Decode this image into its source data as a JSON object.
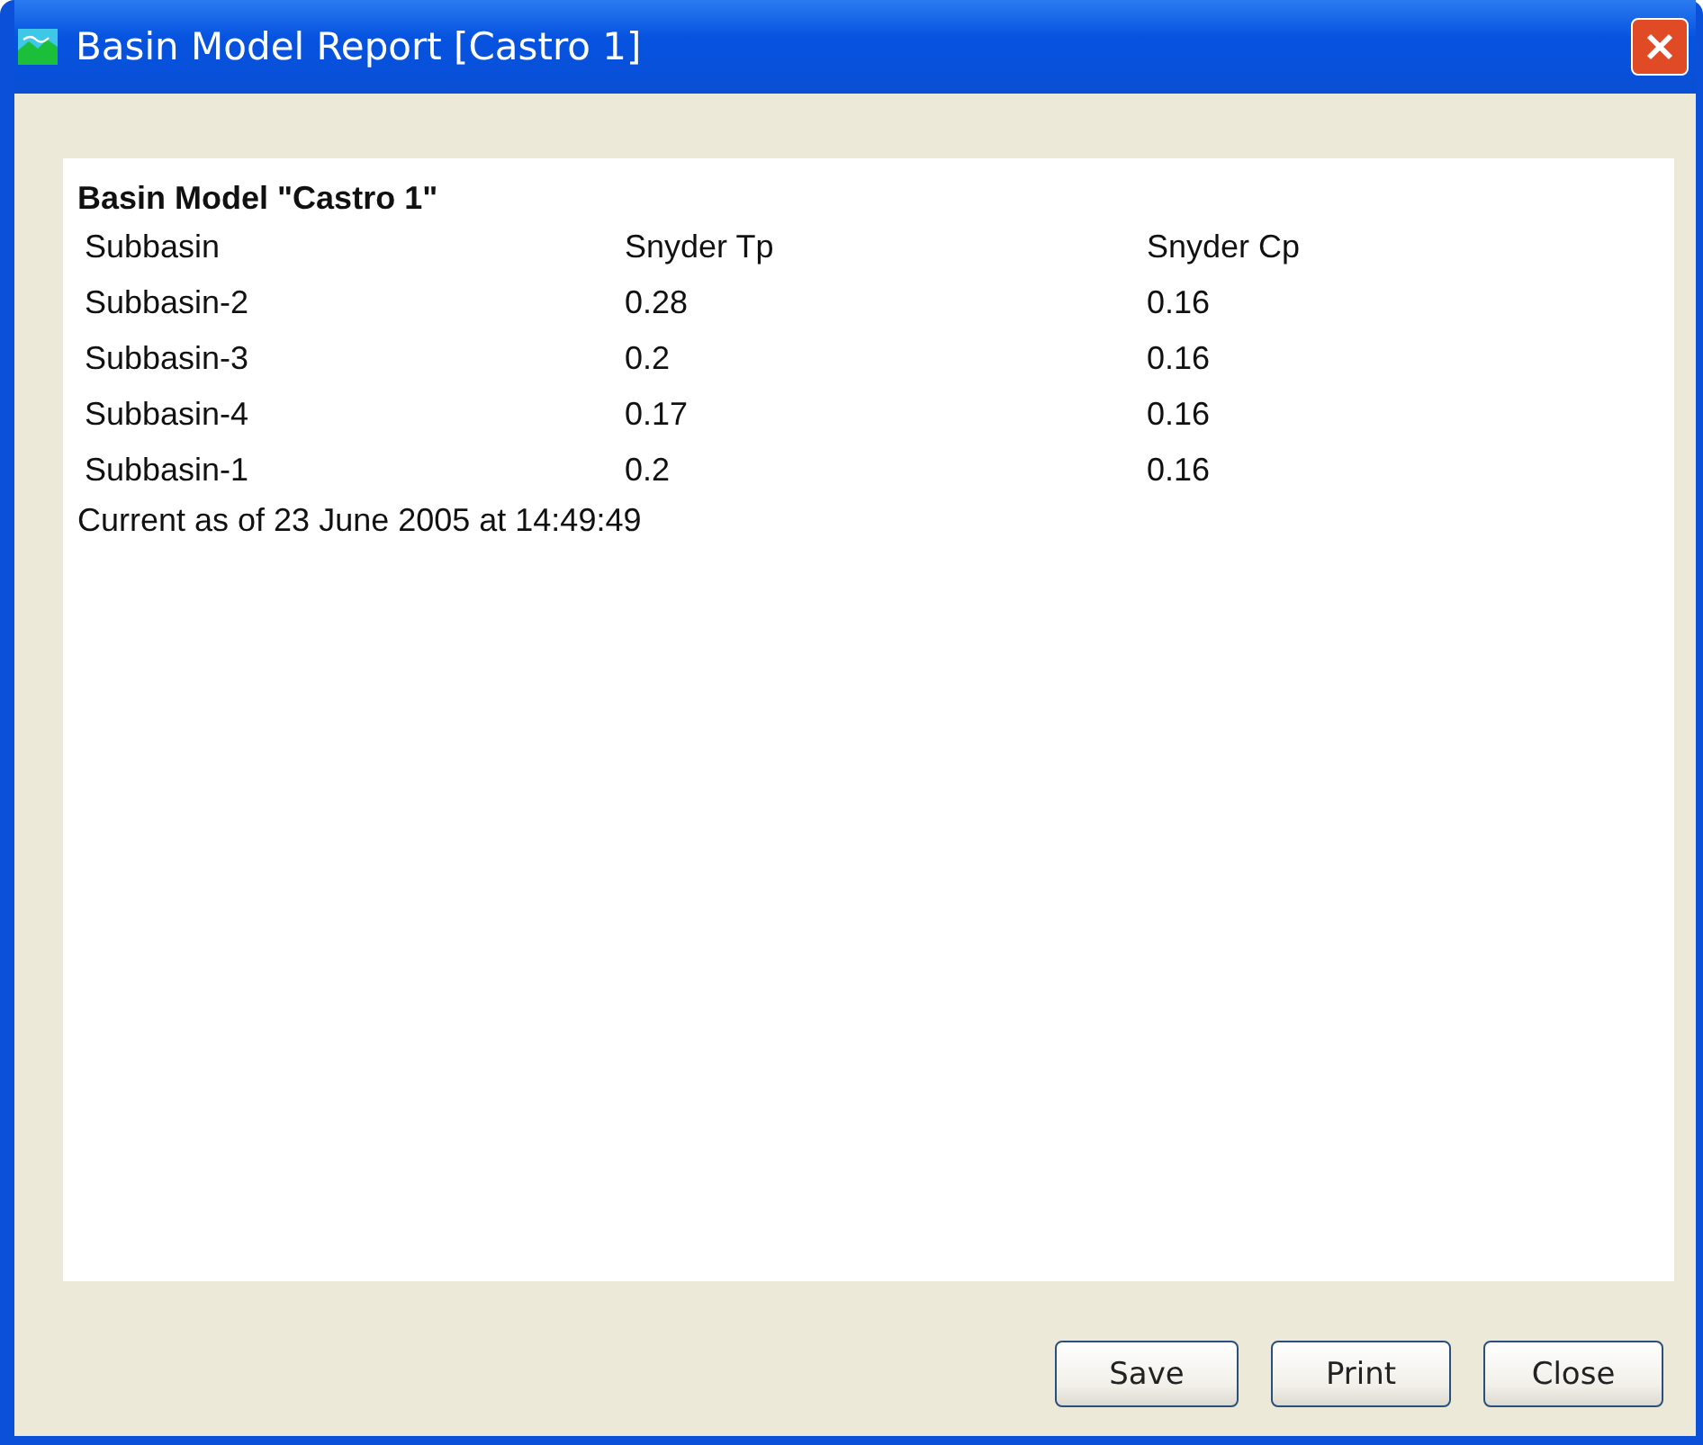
{
  "window": {
    "title": "Basin Model Report [Castro 1]"
  },
  "report": {
    "heading": "Basin Model \"Castro 1\"",
    "columns": [
      "Subbasin",
      "Snyder Tp",
      "Snyder Cp"
    ],
    "rows": [
      [
        "Subbasin-2",
        "0.28",
        "0.16"
      ],
      [
        "Subbasin-3",
        "0.2",
        "0.16"
      ],
      [
        "Subbasin-4",
        "0.17",
        "0.16"
      ],
      [
        "Subbasin-1",
        "0.2",
        "0.16"
      ]
    ],
    "footer": "Current as of 23 June 2005 at 14:49:49"
  },
  "buttons": [
    "Save",
    "Print",
    "Close"
  ]
}
